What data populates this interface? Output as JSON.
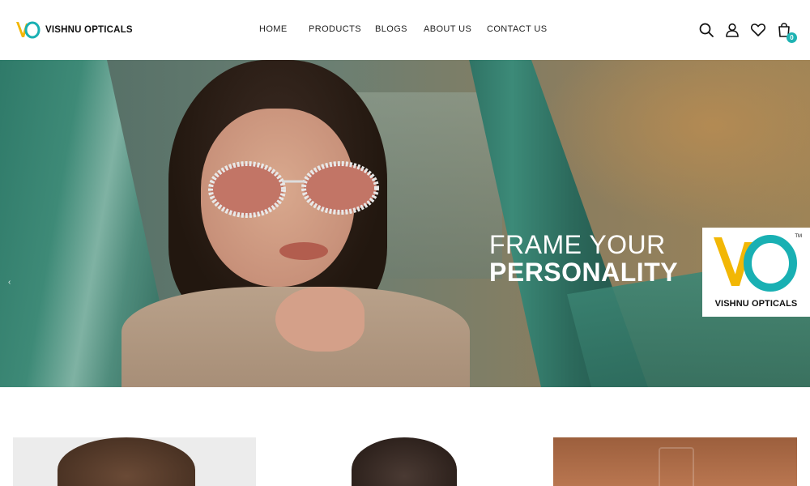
{
  "brand": {
    "logo_text": "VO",
    "name": "VISHNU OPTICALS"
  },
  "nav": [
    {
      "label": "HOME"
    },
    {
      "label": "PRODUCTS"
    },
    {
      "label": "BLOGS"
    },
    {
      "label": "ABOUT US"
    },
    {
      "label": "CONTACT US"
    }
  ],
  "header_icons": [
    {
      "name": "search-icon"
    },
    {
      "name": "user-icon"
    },
    {
      "name": "heart-icon"
    },
    {
      "name": "bag-icon",
      "badge": "0"
    }
  ],
  "hero": {
    "line1": "FRAME YOUR",
    "line2": "PERSONALITY",
    "badge": {
      "logo_text": "VO",
      "trademark": "TM",
      "name": "VISHNU OPTICALS"
    },
    "prev_arrow": "‹",
    "next_arrow": "›"
  },
  "colors": {
    "accent": "#1fb3b3",
    "logo_yellow": "#f2b705",
    "logo_teal": "#19b0b3"
  }
}
